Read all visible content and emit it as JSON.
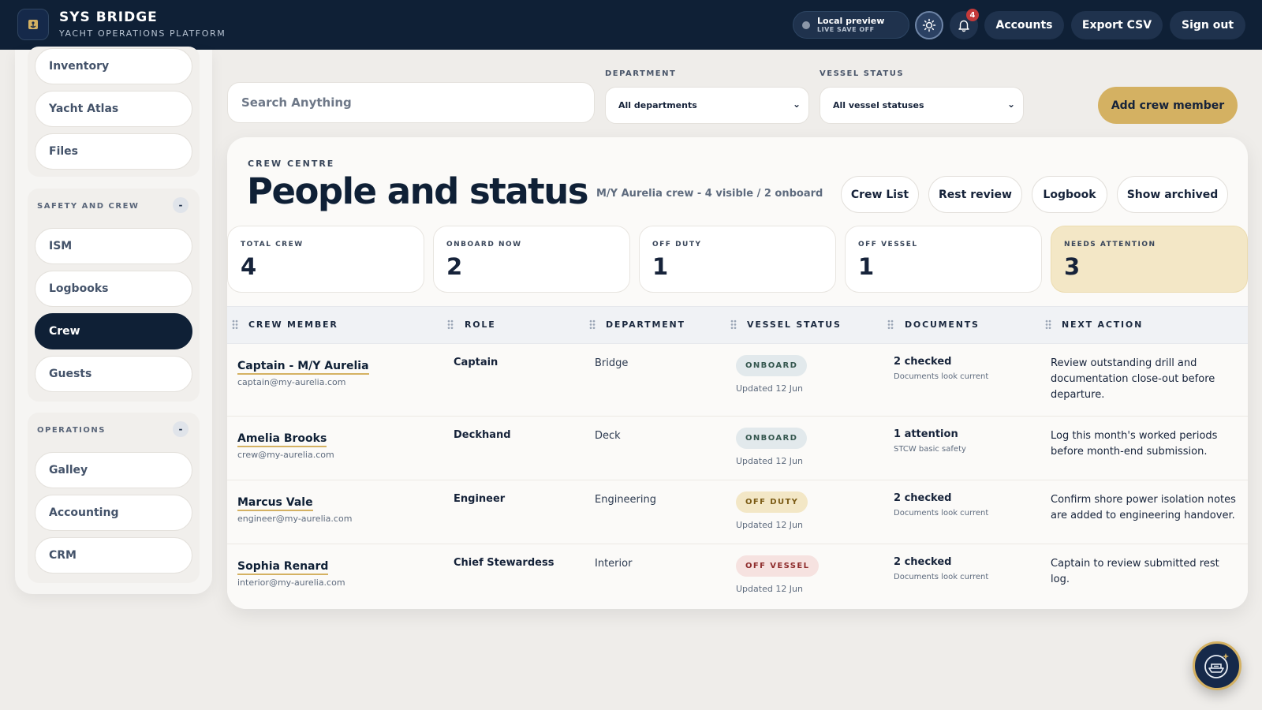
{
  "app": {
    "title": "SYS BRIDGE",
    "subtitle": "YACHT OPERATIONS PLATFORM",
    "preview_title": "Local preview",
    "preview_sub": "LIVE SAVE OFF",
    "notification_count": "4",
    "nav": [
      "Accounts",
      "Export CSV",
      "Sign out"
    ]
  },
  "sidebar": {
    "top_items": [
      "Inventory",
      "Yacht Atlas",
      "Files"
    ],
    "safety": {
      "title": "SAFETY AND CREW",
      "toggle": "-",
      "items": [
        "ISM",
        "Logbooks",
        "Crew",
        "Guests"
      ],
      "active": "Crew"
    },
    "operations": {
      "title": "OPERATIONS",
      "toggle": "-",
      "items": [
        "Galley",
        "Accounting",
        "CRM"
      ]
    }
  },
  "filters": {
    "search_placeholder": "Search Anything",
    "department_label": "DEPARTMENT",
    "department_value": "All departments",
    "status_label": "VESSEL STATUS",
    "status_value": "All vessel statuses",
    "add_button": "Add crew member"
  },
  "panel": {
    "eyebrow": "CREW CENTRE",
    "title": "People and status",
    "summary": "M/Y Aurelia crew - 4 visible / 2 onboard",
    "actions": [
      "Crew List",
      "Rest review",
      "Logbook",
      "Show archived"
    ]
  },
  "stats": [
    {
      "label": "TOTAL CREW",
      "value": "4"
    },
    {
      "label": "ONBOARD NOW",
      "value": "2"
    },
    {
      "label": "OFF DUTY",
      "value": "1"
    },
    {
      "label": "OFF VESSEL",
      "value": "1"
    },
    {
      "label": "NEEDS ATTENTION",
      "value": "3"
    }
  ],
  "table": {
    "columns": [
      "CREW MEMBER",
      "ROLE",
      "DEPARTMENT",
      "VESSEL STATUS",
      "DOCUMENTS",
      "NEXT ACTION"
    ],
    "rows": [
      {
        "name": "Captain - M/Y Aurelia",
        "email": "captain@my-aurelia.com",
        "role": "Captain",
        "department": "Bridge",
        "status": "ONBOARD",
        "updated": "Updated 12 Jun",
        "doc_main": "2 checked",
        "doc_sub": "Documents look current",
        "next_action": "Review outstanding drill and documentation close-out before departure."
      },
      {
        "name": "Amelia Brooks",
        "email": "crew@my-aurelia.com",
        "role": "Deckhand",
        "department": "Deck",
        "status": "ONBOARD",
        "updated": "Updated 12 Jun",
        "doc_main": "1 attention",
        "doc_sub": "STCW basic safety",
        "next_action": "Log this month's worked periods before month-end submission."
      },
      {
        "name": "Marcus Vale",
        "email": "engineer@my-aurelia.com",
        "role": "Engineer",
        "department": "Engineering",
        "status": "OFF DUTY",
        "updated": "Updated 12 Jun",
        "doc_main": "2 checked",
        "doc_sub": "Documents look current",
        "next_action": "Confirm shore power isolation notes are added to engineering handover."
      },
      {
        "name": "Sophia Renard",
        "email": "interior@my-aurelia.com",
        "role": "Chief Stewardess",
        "department": "Interior",
        "status": "OFF VESSEL",
        "updated": "Updated 12 Jun",
        "doc_main": "2 checked",
        "doc_sub": "Documents look current",
        "next_action": "Captain to review submitted rest log."
      }
    ]
  }
}
